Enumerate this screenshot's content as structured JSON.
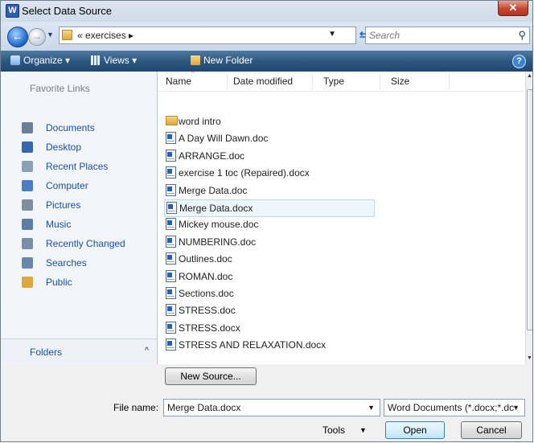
{
  "window": {
    "title": "Select Data Source",
    "app_icon_letter": "W",
    "close_glyph": "✕"
  },
  "address": {
    "path": "« exercises ▸",
    "search_placeholder": "Search"
  },
  "toolbar": {
    "organize": "Organize ▾",
    "views": "Views ▾",
    "new_folder": "New Folder"
  },
  "favorites": {
    "header": "Favorite Links",
    "items": [
      {
        "label": "Documents",
        "color": "#6d7f94"
      },
      {
        "label": "Desktop",
        "color": "#3566b0"
      },
      {
        "label": "Recent Places",
        "color": "#8aa0b8"
      },
      {
        "label": "Computer",
        "color": "#4a7dc2"
      },
      {
        "label": "Pictures",
        "color": "#7d8e9f"
      },
      {
        "label": "Music",
        "color": "#5b7fa8"
      },
      {
        "label": "Recently Changed",
        "color": "#7c8ea4"
      },
      {
        "label": "Searches",
        "color": "#6a86a8"
      },
      {
        "label": "Public",
        "color": "#dca73d"
      }
    ],
    "folders_label": "Folders",
    "folders_chevron": "^"
  },
  "columns": [
    "Name",
    "Date modified",
    "Type",
    "Size"
  ],
  "files": [
    {
      "name": "word intro",
      "kind": "folder"
    },
    {
      "name": "A Day Will Dawn.doc",
      "kind": "doc"
    },
    {
      "name": "ARRANGE.doc",
      "kind": "doc"
    },
    {
      "name": "exercise 1 toc (Repaired).docx",
      "kind": "doc"
    },
    {
      "name": "Merge Data.doc",
      "kind": "doc"
    },
    {
      "name": "Merge Data.docx",
      "kind": "doc",
      "selected": true
    },
    {
      "name": "Mickey mouse.doc",
      "kind": "doc"
    },
    {
      "name": "NUMBERING.doc",
      "kind": "doc"
    },
    {
      "name": "Outlines.doc",
      "kind": "doc"
    },
    {
      "name": "ROMAN.doc",
      "kind": "doc"
    },
    {
      "name": "Sections.doc",
      "kind": "doc"
    },
    {
      "name": "STRESS.doc",
      "kind": "doc"
    },
    {
      "name": "STRESS.docx",
      "kind": "doc"
    },
    {
      "name": "STRESS AND RELAXATION.docx",
      "kind": "doc"
    }
  ],
  "footer": {
    "new_source": "New Source...",
    "file_name_label": "File name:",
    "file_name_value": "Merge Data.docx",
    "file_type": "Word Documents (*.docx;*.dc",
    "tools": "Tools",
    "open": "Open",
    "cancel": "Cancel"
  }
}
